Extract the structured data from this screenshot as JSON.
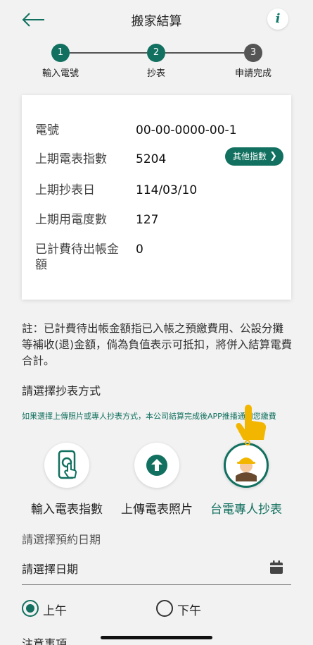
{
  "header": {
    "title": "搬家結算",
    "info_symbol": "i"
  },
  "steps": [
    {
      "number": "1",
      "label": "輸入電號",
      "state": "active"
    },
    {
      "number": "2",
      "label": "抄表",
      "state": "active"
    },
    {
      "number": "3",
      "label": "申請完成",
      "state": "inactive"
    }
  ],
  "info_card": {
    "rows": [
      {
        "label": "電號",
        "value": "00-00-0000-00-1"
      },
      {
        "label": "上期電表指數",
        "value": "5204"
      },
      {
        "label": "上期抄表日",
        "value": "114/03/10"
      },
      {
        "label": "上期用電度數",
        "value": "127"
      },
      {
        "label": "已計費待出帳金額",
        "value": "0"
      }
    ],
    "other_button": "其他指數"
  },
  "note": "註：已計費待出帳金額指已入帳之預繳費用、公設分攤等補收(退)金額，倘為負值表示可抵扣，將併入結算電費合計。",
  "method_section": {
    "title": "請選擇抄表方式",
    "hint": "如果選擇上傳照片或專人抄表方式，本公司結算完成後APP推播通知您繳費",
    "options": [
      {
        "label": "輸入電表指數",
        "icon": "phone-touch-icon",
        "selected": false
      },
      {
        "label": "上傳電表照片",
        "icon": "upload-arrow-icon",
        "selected": false
      },
      {
        "label": "台電專人抄表",
        "icon": "worker-helmet-icon",
        "selected": true
      }
    ]
  },
  "appointment": {
    "title": "請選擇預約日期",
    "date_placeholder": "請選擇日期",
    "periods": [
      {
        "label": "上午",
        "selected": true
      },
      {
        "label": "下午",
        "selected": false
      }
    ]
  },
  "notes_title": "注意事項",
  "colors": {
    "accent": "#11705f",
    "background": "#f2f2f2",
    "pointer": "#f3b600"
  }
}
